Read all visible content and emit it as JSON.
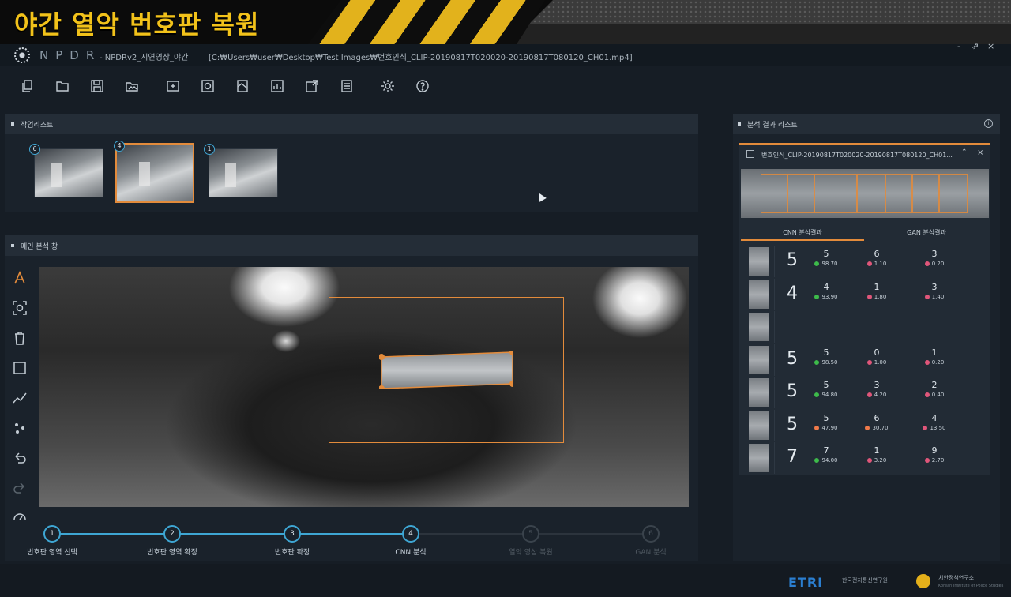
{
  "banner": {
    "title": "야간 열악 번호판 복원"
  },
  "window": {
    "logo_text": "NPDR",
    "app_name": "- NPDRv2_시연영상_야간",
    "file_path": "[C:₩Users₩user₩Desktop₩Test Images₩번호인식_CLIP-20190817T020020-20190817T080120_CH01.mp4]",
    "controls": [
      "-",
      "⇗",
      "×"
    ]
  },
  "toolbar": {
    "icons": [
      "copy-icon",
      "folder-icon",
      "save-icon",
      "folder-image-icon",
      "roi-icon",
      "target-icon",
      "image-adjust-icon",
      "chart-icon",
      "image-export-icon",
      "list-icon",
      "settings-icon",
      "help-icon"
    ]
  },
  "work_list": {
    "title": "작업리스트",
    "items": [
      {
        "badge": "6",
        "selected": false
      },
      {
        "badge": "4",
        "selected": true
      },
      {
        "badge": "1",
        "selected": false
      }
    ]
  },
  "main_panel": {
    "title": "메인 분석 창"
  },
  "side_tools": [
    "text-tool-icon",
    "focus-tool-icon",
    "delete-tool-icon",
    "rect-tool-icon",
    "line-tool-icon",
    "points-tool-icon",
    "undo-icon",
    "redo-icon",
    "gauge-icon"
  ],
  "stepper": {
    "steps": [
      {
        "num": "1",
        "label": "번호판 영역 선택",
        "active": true
      },
      {
        "num": "2",
        "label": "번호판 영역 확정",
        "active": true
      },
      {
        "num": "3",
        "label": "번호판 확정",
        "active": true
      },
      {
        "num": "4",
        "label": "CNN 분석",
        "active": true
      },
      {
        "num": "5",
        "label": "열악 영상 복원",
        "active": false
      },
      {
        "num": "6",
        "label": "GAN 분석",
        "active": false
      }
    ]
  },
  "results": {
    "title": "분석 결과 리스트",
    "card_title": "번호인식_CLIP-20190817T020020-20190817T080120_CH01...",
    "tabs": [
      "CNN 분석결과",
      "GAN 분석결과"
    ],
    "rows": [
      {
        "best": "5",
        "cands": [
          {
            "d": "5",
            "s": "98.70",
            "c": "green"
          },
          {
            "d": "6",
            "s": "1.10",
            "c": "pink"
          },
          {
            "d": "3",
            "s": "0.20",
            "c": "pink"
          }
        ]
      },
      {
        "best": "4",
        "cands": [
          {
            "d": "4",
            "s": "93.90",
            "c": "green"
          },
          {
            "d": "1",
            "s": "1.80",
            "c": "pink"
          },
          {
            "d": "3",
            "s": "1.40",
            "c": "pink"
          }
        ]
      },
      {
        "best": "",
        "cands": []
      },
      {
        "best": "5",
        "cands": [
          {
            "d": "5",
            "s": "98.50",
            "c": "green"
          },
          {
            "d": "0",
            "s": "1.00",
            "c": "pink"
          },
          {
            "d": "1",
            "s": "0.20",
            "c": "pink"
          }
        ]
      },
      {
        "best": "5",
        "cands": [
          {
            "d": "5",
            "s": "94.80",
            "c": "green"
          },
          {
            "d": "3",
            "s": "4.20",
            "c": "pink"
          },
          {
            "d": "2",
            "s": "0.40",
            "c": "pink"
          }
        ]
      },
      {
        "best": "5",
        "cands": [
          {
            "d": "5",
            "s": "47.90",
            "c": "orange"
          },
          {
            "d": "6",
            "s": "30.70",
            "c": "orange"
          },
          {
            "d": "4",
            "s": "13.50",
            "c": "pink"
          }
        ]
      },
      {
        "best": "7",
        "cands": [
          {
            "d": "7",
            "s": "94.00",
            "c": "green"
          },
          {
            "d": "1",
            "s": "3.20",
            "c": "pink"
          },
          {
            "d": "9",
            "s": "2.70",
            "c": "pink"
          }
        ]
      }
    ]
  },
  "footer": {
    "etri": "ETRI",
    "etri_sub": "한국전자통신연구원",
    "police": "치안정책연구소",
    "police_sub": "Korean Institute of Police Studies"
  },
  "colors": {
    "accent": "#e38b3b",
    "step": "#3ea6d3",
    "green": "#3dbb4a",
    "pink": "#e0567a",
    "orange": "#f07a4a"
  }
}
